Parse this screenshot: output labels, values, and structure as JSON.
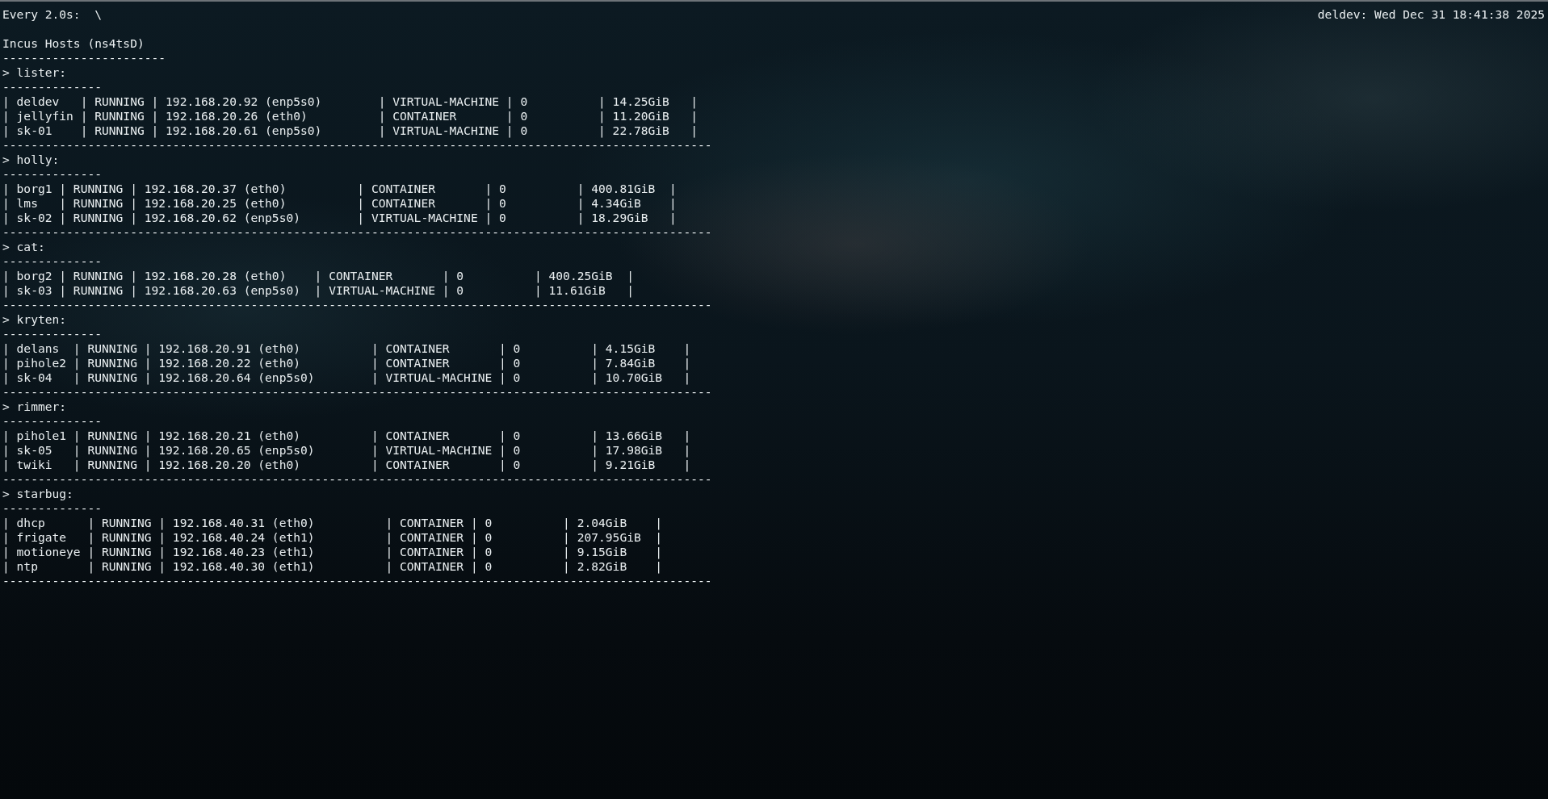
{
  "header": {
    "command": "Every 2.0s:  \\",
    "host_time": "deldev: Wed Dec 31 18:41:38 2025"
  },
  "title": "Incus Hosts (ns4tsD)",
  "title_rule": "-----------------------",
  "hosts": [
    {
      "heading": "> lister:",
      "rule": "--------------",
      "rows": [
        "| deldev   | RUNNING | 192.168.20.92 (enp5s0)        | VIRTUAL-MACHINE | 0          | 14.25GiB   |",
        "| jellyfin | RUNNING | 192.168.20.26 (eth0)          | CONTAINER       | 0          | 11.20GiB   |",
        "| sk-01    | RUNNING | 192.168.20.61 (enp5s0)        | VIRTUAL-MACHINE | 0          | 22.78GiB   |"
      ],
      "separator": "----------------------------------------------------------------------------------------------------"
    },
    {
      "heading": "> holly:",
      "rule": "--------------",
      "rows": [
        "| borg1 | RUNNING | 192.168.20.37 (eth0)          | CONTAINER       | 0          | 400.81GiB  |",
        "| lms   | RUNNING | 192.168.20.25 (eth0)          | CONTAINER       | 0          | 4.34GiB    |",
        "| sk-02 | RUNNING | 192.168.20.62 (enp5s0)        | VIRTUAL-MACHINE | 0          | 18.29GiB   |"
      ],
      "separator": "----------------------------------------------------------------------------------------------------"
    },
    {
      "heading": "> cat:",
      "rule": "--------------",
      "rows": [
        "| borg2 | RUNNING | 192.168.20.28 (eth0)    | CONTAINER       | 0          | 400.25GiB  |",
        "| sk-03 | RUNNING | 192.168.20.63 (enp5s0)  | VIRTUAL-MACHINE | 0          | 11.61GiB   |"
      ],
      "separator": "----------------------------------------------------------------------------------------------------"
    },
    {
      "heading": "> kryten:",
      "rule": "--------------",
      "rows": [
        "| delans  | RUNNING | 192.168.20.91 (eth0)          | CONTAINER       | 0          | 4.15GiB    |",
        "| pihole2 | RUNNING | 192.168.20.22 (eth0)          | CONTAINER       | 0          | 7.84GiB    |",
        "| sk-04   | RUNNING | 192.168.20.64 (enp5s0)        | VIRTUAL-MACHINE | 0          | 10.70GiB   |"
      ],
      "separator": "----------------------------------------------------------------------------------------------------"
    },
    {
      "heading": "> rimmer:",
      "rule": "--------------",
      "rows": [
        "| pihole1 | RUNNING | 192.168.20.21 (eth0)          | CONTAINER       | 0          | 13.66GiB   |",
        "| sk-05   | RUNNING | 192.168.20.65 (enp5s0)        | VIRTUAL-MACHINE | 0          | 17.98GiB   |",
        "| twiki   | RUNNING | 192.168.20.20 (eth0)          | CONTAINER       | 0          | 9.21GiB    |"
      ],
      "separator": "----------------------------------------------------------------------------------------------------"
    },
    {
      "heading": "> starbug:",
      "rule": "--------------",
      "rows": [
        "| dhcp      | RUNNING | 192.168.40.31 (eth0)          | CONTAINER | 0          | 2.04GiB    |",
        "| frigate   | RUNNING | 192.168.40.24 (eth1)          | CONTAINER | 0          | 207.95GiB  |",
        "| motioneye | RUNNING | 192.168.40.23 (eth1)          | CONTAINER | 0          | 9.15GiB    |",
        "| ntp       | RUNNING | 192.168.40.30 (eth1)          | CONTAINER | 0          | 2.82GiB    |"
      ],
      "separator": "----------------------------------------------------------------------------------------------------"
    }
  ]
}
